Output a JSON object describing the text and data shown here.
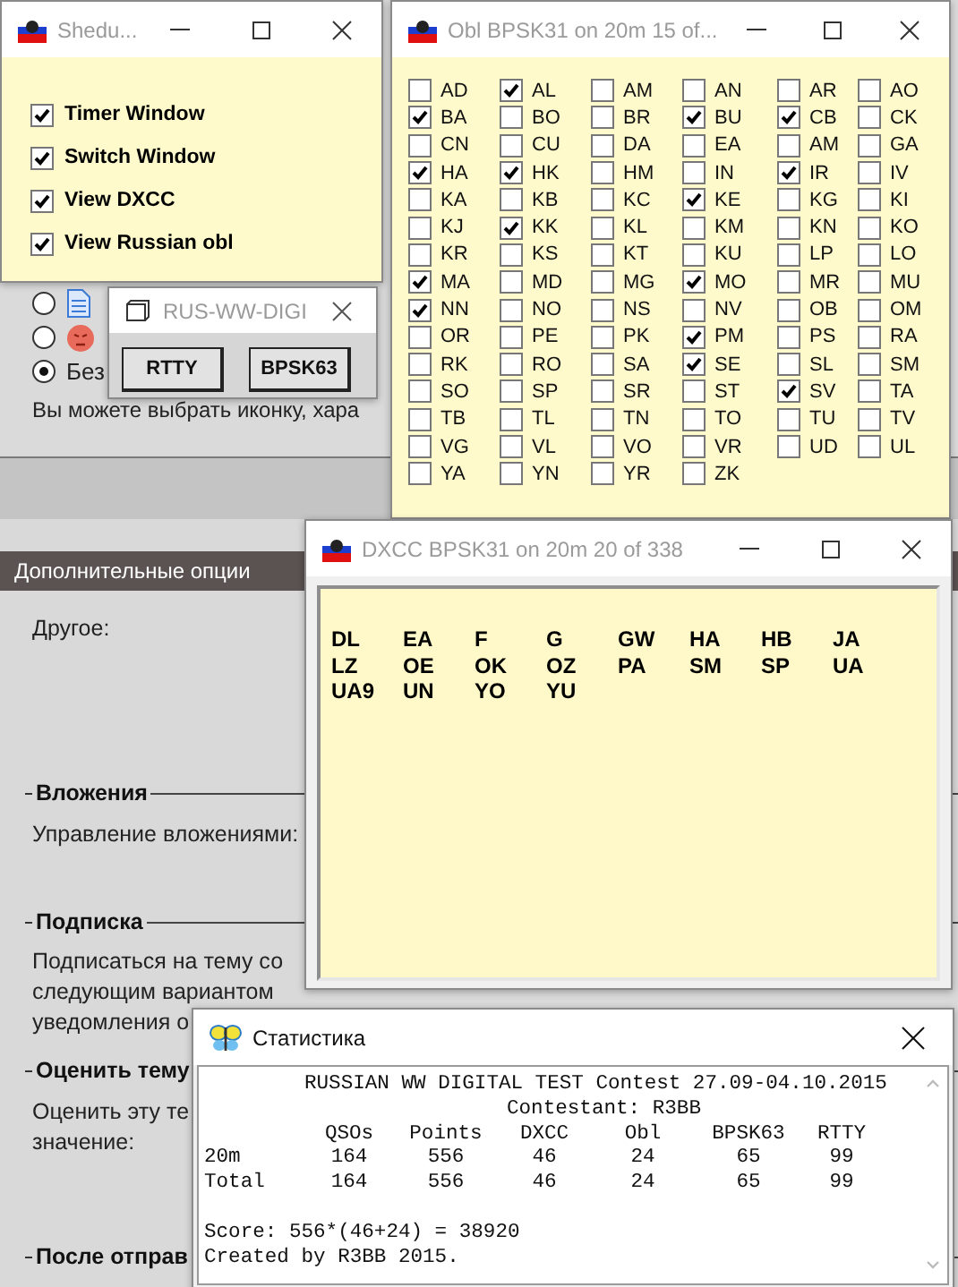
{
  "page": {
    "radio_options": [
      {
        "kind": "document",
        "selected": false
      },
      {
        "kind": "emoji",
        "selected": false
      },
      {
        "kind": "text",
        "label": "Без",
        "selected": true
      }
    ],
    "hint": "Вы можете выбрать иконку, хара",
    "section_header": "Дополнительные опции",
    "other_label": "Другое:",
    "sections": [
      {
        "title": "Вложения",
        "lines": [
          "Управление вложениями:"
        ]
      },
      {
        "title": "Подписка",
        "lines": [
          "Подписаться на тему со",
          "следующим вариантом",
          "уведомления о"
        ]
      },
      {
        "title": "Оценить тему",
        "lines": [
          "Оценить эту те",
          "значение:"
        ]
      },
      {
        "title": "После отправ"
      }
    ]
  },
  "schedule_window": {
    "title": "Shedu...",
    "active": false,
    "options": [
      {
        "label": "Timer Window",
        "checked": true
      },
      {
        "label": "Switch Window",
        "checked": true
      },
      {
        "label": "View DXCC",
        "checked": true
      },
      {
        "label": "View Russian obl",
        "checked": true
      }
    ]
  },
  "mode_window": {
    "title": "RUS-WW-DIGI",
    "active": false,
    "buttons": [
      "RTTY",
      "BPSK63"
    ]
  },
  "obl_window": {
    "title": "Obl BPSK31 on 20m 15 of...",
    "active": false,
    "columns": [
      {
        "items": [
          {
            "label": "AD",
            "checked": false
          },
          {
            "label": "BA",
            "checked": true
          },
          {
            "label": "CN",
            "checked": false
          },
          {
            "label": "HA",
            "checked": true
          },
          {
            "label": "KA",
            "checked": false
          },
          {
            "label": "KJ",
            "checked": false
          },
          {
            "label": "KR",
            "checked": false
          },
          {
            "label": "MA",
            "checked": true
          },
          {
            "label": "NN",
            "checked": true
          },
          {
            "label": "OR",
            "checked": false
          },
          {
            "label": "RK",
            "checked": false
          },
          {
            "label": "SO",
            "checked": false
          },
          {
            "label": "TB",
            "checked": false
          },
          {
            "label": "VG",
            "checked": false
          },
          {
            "label": "YA",
            "checked": false
          }
        ]
      },
      {
        "items": [
          {
            "label": "AL",
            "checked": true
          },
          {
            "label": "BO",
            "checked": false
          },
          {
            "label": "CU",
            "checked": false
          },
          {
            "label": "HK",
            "checked": true
          },
          {
            "label": "KB",
            "checked": false
          },
          {
            "label": "KK",
            "checked": true
          },
          {
            "label": "KS",
            "checked": false
          },
          {
            "label": "MD",
            "checked": false
          },
          {
            "label": "NO",
            "checked": false
          },
          {
            "label": "PE",
            "checked": false
          },
          {
            "label": "RO",
            "checked": false
          },
          {
            "label": "SP",
            "checked": false
          },
          {
            "label": "TL",
            "checked": false
          },
          {
            "label": "VL",
            "checked": false
          },
          {
            "label": "YN",
            "checked": false
          }
        ]
      },
      {
        "items": [
          {
            "label": "AM",
            "checked": false
          },
          {
            "label": "BR",
            "checked": false
          },
          {
            "label": "DA",
            "checked": false
          },
          {
            "label": "HM",
            "checked": false
          },
          {
            "label": "KC",
            "checked": false
          },
          {
            "label": "KL",
            "checked": false
          },
          {
            "label": "KT",
            "checked": false
          },
          {
            "label": "MG",
            "checked": false
          },
          {
            "label": "NS",
            "checked": false
          },
          {
            "label": "PK",
            "checked": false
          },
          {
            "label": "SA",
            "checked": false
          },
          {
            "label": "SR",
            "checked": false
          },
          {
            "label": "TN",
            "checked": false
          },
          {
            "label": "VO",
            "checked": false
          },
          {
            "label": "YR",
            "checked": false
          }
        ]
      },
      {
        "items": [
          {
            "label": "AN",
            "checked": false
          },
          {
            "label": "BU",
            "checked": true
          },
          {
            "label": "EA",
            "checked": false
          },
          {
            "label": "IN",
            "checked": false
          },
          {
            "label": "KE",
            "checked": true
          },
          {
            "label": "KM",
            "checked": false
          },
          {
            "label": "KU",
            "checked": false
          },
          {
            "label": "MO",
            "checked": true
          },
          {
            "label": "NV",
            "checked": false
          },
          {
            "label": "PM",
            "checked": true
          },
          {
            "label": "SE",
            "checked": true
          },
          {
            "label": "ST",
            "checked": false
          },
          {
            "label": "TO",
            "checked": false
          },
          {
            "label": "VR",
            "checked": false
          },
          {
            "label": "ZK",
            "checked": false
          }
        ]
      },
      {
        "items": [
          {
            "label": "AR",
            "checked": false
          },
          {
            "label": "CB",
            "checked": true
          },
          {
            "label": "AM",
            "checked": false
          },
          {
            "label": "IR",
            "checked": true
          },
          {
            "label": "KG",
            "checked": false
          },
          {
            "label": "KN",
            "checked": false
          },
          {
            "label": "LP",
            "checked": false
          },
          {
            "label": "MR",
            "checked": false
          },
          {
            "label": "OB",
            "checked": false
          },
          {
            "label": "PS",
            "checked": false
          },
          {
            "label": "SL",
            "checked": false
          },
          {
            "label": "SV",
            "checked": true
          },
          {
            "label": "TU",
            "checked": false
          },
          {
            "label": "UD",
            "checked": false
          }
        ]
      },
      {
        "items": [
          {
            "label": "AO",
            "checked": false
          },
          {
            "label": "CK",
            "checked": false
          },
          {
            "label": "GA",
            "checked": false
          },
          {
            "label": "IV",
            "checked": false
          },
          {
            "label": "KI",
            "checked": false
          },
          {
            "label": "KO",
            "checked": false
          },
          {
            "label": "LO",
            "checked": false
          },
          {
            "label": "MU",
            "checked": false
          },
          {
            "label": "OM",
            "checked": false
          },
          {
            "label": "RA",
            "checked": false
          },
          {
            "label": "SM",
            "checked": false
          },
          {
            "label": "TA",
            "checked": false
          },
          {
            "label": "TV",
            "checked": false
          },
          {
            "label": "UL",
            "checked": false
          }
        ]
      }
    ]
  },
  "dxcc_window": {
    "title": "DXCC BPSK31 on 20m 20 of 338",
    "active": false,
    "entries": [
      "DL",
      "EA",
      "F",
      "G",
      "GW",
      "HA",
      "HB",
      "JA",
      "LZ",
      "OE",
      "OK",
      "OZ",
      "PA",
      "SM",
      "SP",
      "UA",
      "UA9",
      "UN",
      "YO",
      "YU"
    ]
  },
  "stats_window": {
    "title": "Статистика",
    "active": true,
    "heading": "RUSSIAN WW DIGITAL TEST Contest 27.09-04.10.2015",
    "contestant": "Contestant: R3BB",
    "columns": [
      "QSOs",
      "Points",
      "DXCC",
      "Obl",
      "BPSK63",
      "RTTY"
    ],
    "rows": [
      {
        "label": "20m",
        "values": [
          "164",
          "556",
          "46",
          "24",
          "65",
          "99"
        ]
      },
      {
        "label": "Total",
        "values": [
          "164",
          "556",
          "46",
          "24",
          "65",
          "99"
        ]
      }
    ],
    "score": "Score: 556*(46+24) = 38920",
    "credit": "Created by R3BB 2015."
  }
}
